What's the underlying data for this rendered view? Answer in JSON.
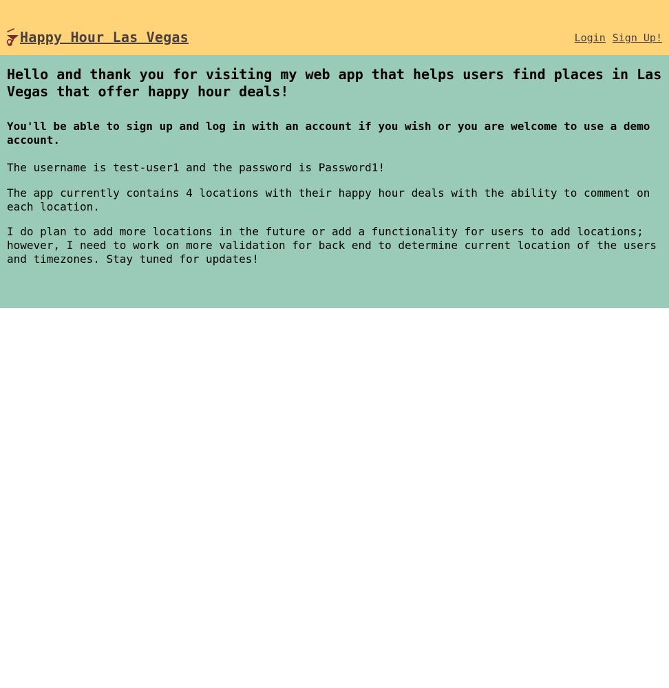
{
  "header": {
    "logo_icon": "cocktail-glass-icon",
    "title": "Happy Hour Las Vegas",
    "nav": {
      "login_label": "Login",
      "signup_label": "Sign Up!"
    }
  },
  "main": {
    "heading": "Hello and thank you for visiting my web app that helps users find places in Las Vegas that offer happy hour deals!",
    "subheading": "You'll be able to sign up and log in with an account if you wish or you are welcome to use a demo account.",
    "credentials": "The username is test-user1 and the password is Password1!",
    "locations_info": "The app currently contains 4 locations with their happy hour deals with the ability to comment on each location.",
    "plans": "I do plan to add more locations in the future or add a functionality for users to add locations; however, I need to work on more validation for back end to determine current location of the users and timezones. Stay tuned for updates!"
  },
  "colors": {
    "header_bg": "#ffd479",
    "main_bg": "#99cbb8",
    "title_text": "#4a4040",
    "icon": "#7a2a2a"
  }
}
